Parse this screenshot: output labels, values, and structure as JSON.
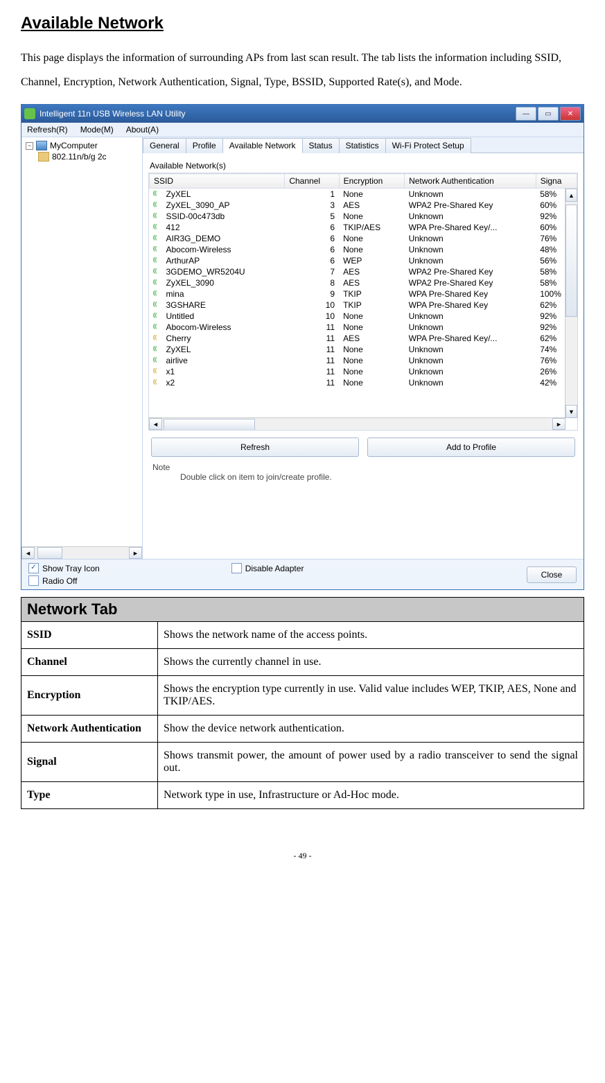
{
  "doc": {
    "heading": "Available Network",
    "intro": "This page displays the information of surrounding APs from last scan result. The tab lists the information including SSID, Channel, Encryption, Network Authentication, Signal, Type, BSSID, Supported Rate(s), and Mode.",
    "page_number": "- 49 -"
  },
  "app": {
    "title": "Intelligent 11n USB Wireless LAN Utility",
    "menu": {
      "refresh": "Refresh(R)",
      "mode": "Mode(M)",
      "about": "About(A)"
    },
    "tree": {
      "root": "MyComputer",
      "child": "802.11n/b/g 2c"
    },
    "tabs": [
      "General",
      "Profile",
      "Available Network",
      "Status",
      "Statistics",
      "Wi-Fi Protect Setup"
    ],
    "active_tab_index": 2,
    "group_label": "Available Network(s)",
    "columns": [
      "SSID",
      "Channel",
      "Encryption",
      "Network Authentication",
      "Signa"
    ],
    "rows": [
      {
        "ssid": "ZyXEL",
        "channel": "1",
        "enc": "None",
        "auth": "Unknown",
        "signal": "58%",
        "low": false
      },
      {
        "ssid": "ZyXEL_3090_AP",
        "channel": "3",
        "enc": "AES",
        "auth": "WPA2 Pre-Shared Key",
        "signal": "60%",
        "low": false
      },
      {
        "ssid": "SSID-00c473db",
        "channel": "5",
        "enc": "None",
        "auth": "Unknown",
        "signal": "92%",
        "low": false
      },
      {
        "ssid": "412",
        "channel": "6",
        "enc": "TKIP/AES",
        "auth": "WPA Pre-Shared Key/...",
        "signal": "60%",
        "low": false
      },
      {
        "ssid": "AIR3G_DEMO",
        "channel": "6",
        "enc": "None",
        "auth": "Unknown",
        "signal": "76%",
        "low": false
      },
      {
        "ssid": "Abocom-Wireless",
        "channel": "6",
        "enc": "None",
        "auth": "Unknown",
        "signal": "48%",
        "low": false
      },
      {
        "ssid": "ArthurAP",
        "channel": "6",
        "enc": "WEP",
        "auth": "Unknown",
        "signal": "56%",
        "low": false
      },
      {
        "ssid": "3GDEMO_WR5204U",
        "channel": "7",
        "enc": "AES",
        "auth": "WPA2 Pre-Shared Key",
        "signal": "58%",
        "low": false
      },
      {
        "ssid": "ZyXEL_3090",
        "channel": "8",
        "enc": "AES",
        "auth": "WPA2 Pre-Shared Key",
        "signal": "58%",
        "low": false
      },
      {
        "ssid": "mina",
        "channel": "9",
        "enc": "TKIP",
        "auth": "WPA Pre-Shared Key",
        "signal": "100%",
        "low": false
      },
      {
        "ssid": "3GSHARE",
        "channel": "10",
        "enc": "TKIP",
        "auth": "WPA Pre-Shared Key",
        "signal": "62%",
        "low": false
      },
      {
        "ssid": "Untitled",
        "channel": "10",
        "enc": "None",
        "auth": "Unknown",
        "signal": "92%",
        "low": false
      },
      {
        "ssid": "Abocom-Wireless",
        "channel": "11",
        "enc": "None",
        "auth": "Unknown",
        "signal": "92%",
        "low": false
      },
      {
        "ssid": "Cherry",
        "channel": "11",
        "enc": "AES",
        "auth": "WPA Pre-Shared Key/...",
        "signal": "62%",
        "low": true
      },
      {
        "ssid": "ZyXEL",
        "channel": "11",
        "enc": "None",
        "auth": "Unknown",
        "signal": "74%",
        "low": false
      },
      {
        "ssid": "airlive",
        "channel": "11",
        "enc": "None",
        "auth": "Unknown",
        "signal": "76%",
        "low": false
      },
      {
        "ssid": "x1",
        "channel": "11",
        "enc": "None",
        "auth": "Unknown",
        "signal": "26%",
        "low": true
      },
      {
        "ssid": "x2",
        "channel": "11",
        "enc": "None",
        "auth": "Unknown",
        "signal": "42%",
        "low": true
      }
    ],
    "buttons": {
      "refresh": "Refresh",
      "add_profile": "Add to Profile"
    },
    "note_label": "Note",
    "note_text": "Double click on item to join/create profile.",
    "footer": {
      "show_tray": "Show Tray Icon",
      "show_tray_checked": true,
      "radio_off": "Radio Off",
      "radio_off_checked": false,
      "disable_adapter": "Disable Adapter",
      "disable_adapter_checked": false,
      "close": "Close"
    }
  },
  "desc_table": {
    "header": "Network Tab",
    "rows": [
      {
        "key": "SSID",
        "val": "Shows the network name of the access points."
      },
      {
        "key": "Channel",
        "val": "Shows the currently channel in use."
      },
      {
        "key": "Encryption",
        "val": "Shows the encryption type currently in use. Valid value includes WEP, TKIP, AES, None and TKIP/AES."
      },
      {
        "key": "Network Authentication",
        "val": "Show the device network authentication."
      },
      {
        "key": "Signal",
        "val": "Shows transmit power, the amount of power used by a radio transceiver to send the signal out.",
        "justify": true
      },
      {
        "key": "Type",
        "val": "Network type in use, Infrastructure or Ad-Hoc mode."
      }
    ]
  }
}
